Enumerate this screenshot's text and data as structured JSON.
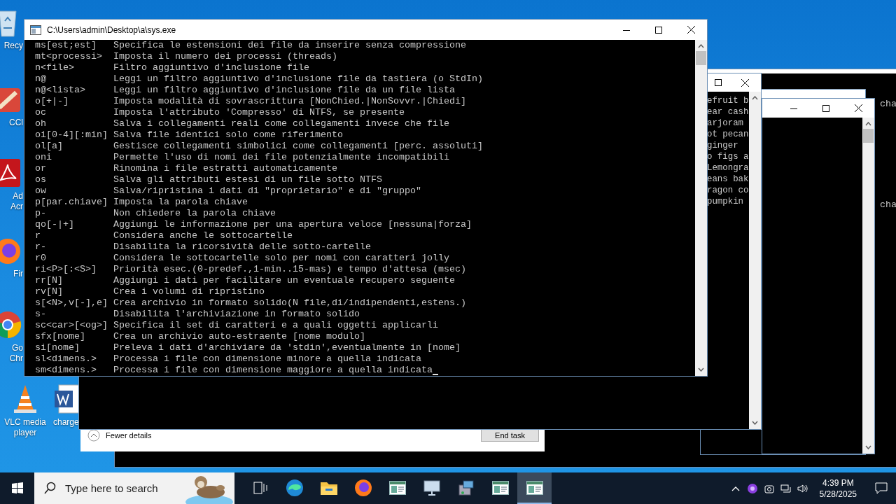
{
  "desktop_icons": [
    {
      "label": "Recy",
      "kind": "recycle"
    },
    {
      "label": "CCl",
      "kind": "ccleaner"
    },
    {
      "label": "Ad Acr",
      "kind": "acrobat"
    },
    {
      "label": "Fir",
      "kind": "firefox"
    },
    {
      "label": "Go Chr",
      "kind": "chrome"
    },
    {
      "label": "VLC media player",
      "kind": "vlc"
    },
    {
      "label": "charge",
      "kind": "word"
    }
  ],
  "back_console": {
    "lines": [
      "efruit b",
      "ear cash",
      "arjoram",
      "ot pecan",
      "ginger",
      "o figs a",
      "Lemongra",
      "eans bak",
      "ragon co",
      "pumpkin"
    ],
    "right_texts": [
      "cha",
      "cha"
    ]
  },
  "task_manager": {
    "toggle": "Fewer details",
    "button": "End task"
  },
  "main_window": {
    "title": "C:\\Users\\admin\\Desktop\\a\\sys.exe",
    "lines": [
      {
        "option": "ms[est;est]",
        "description": "Specifica le estensioni dei file da inserire senza compressione"
      },
      {
        "option": "mt<processi>",
        "description": "Imposta il numero dei processi (threads)"
      },
      {
        "option": "n<file>",
        "description": "Filtro aggiuntivo d'inclusione file"
      },
      {
        "option": "n@",
        "description": "Leggi un filtro aggiuntivo d'inclusione file da tastiera (o StdIn)"
      },
      {
        "option": "n@<lista>",
        "description": "Leggi un filtro aggiuntivo d'inclusione file da un file lista"
      },
      {
        "option": "o[+|-]",
        "description": "Imposta modalità di sovrascrittura [NonChied.|NonSovvr.|Chiedi]"
      },
      {
        "option": "oc",
        "description": "Imposta l'attributo 'Compresso' di NTFS, se presente"
      },
      {
        "option": "oh",
        "description": "Salva i collegamenti reali come collegamenti invece che file"
      },
      {
        "option": "oi[0-4][:min]",
        "description": "Salva file identici solo come riferimento"
      },
      {
        "option": "ol[a]",
        "description": "Gestisce collegamenti simbolici come collegamenti [perc. assoluti]"
      },
      {
        "option": "oni",
        "description": "Permette l'uso di nomi dei file potenzialmente incompatibili"
      },
      {
        "option": "or",
        "description": "Rinomina i file estratti automaticamente"
      },
      {
        "option": "os",
        "description": "Salva gli attributi estesi di un file sotto NTFS"
      },
      {
        "option": "ow",
        "description": "Salva/ripristina i dati di \"proprietario\" e di \"gruppo\""
      },
      {
        "option": "p[par.chiave]",
        "description": "Imposta la parola chiave"
      },
      {
        "option": "p-",
        "description": "Non chiedere la parola chiave"
      },
      {
        "option": "qo[-|+]",
        "description": "Aggiungi le informazione per una apertura veloce [nessuna|forza]"
      },
      {
        "option": "r",
        "description": "Considera anche le sottocartelle"
      },
      {
        "option": "r-",
        "description": "Disabilita la ricorsività delle sotto-cartelle"
      },
      {
        "option": "r0",
        "description": "Considera le sottocartelle solo per nomi con caratteri jolly"
      },
      {
        "option": "ri<P>[:<S>]",
        "description": "Priorità esec.(0-predef.,1-min..15-mas) e tempo d'attesa (msec)"
      },
      {
        "option": "rr[N]",
        "description": "Aggiungi i dati per facilitare un eventuale recupero seguente"
      },
      {
        "option": "rv[N]",
        "description": "Crea i volumi di ripristino"
      },
      {
        "option": "s[<N>,v[-],e]",
        "description": "Crea archivio in formato solido(N file,di/indipendenti,estens.)"
      },
      {
        "option": "s-",
        "description": "Disabilita l'archiviazione in formato solido"
      },
      {
        "option": "sc<car>[<og>]",
        "description": "Specifica il set di caratteri e a quali oggetti applicarli"
      },
      {
        "option": "sfx[nome]",
        "description": "Crea un archivio auto-estraente [nome modulo]"
      },
      {
        "option": "si[nome]",
        "description": "Preleva i dati d'archiviare da 'stdin',eventualmente in [nome]"
      },
      {
        "option": "sl<dimens.>",
        "description": "Processa i file con dimensione minore a quella indicata"
      },
      {
        "option": "sm<dimens.>",
        "description": "Processa i file con dimensione maggiore a quella indicata"
      }
    ]
  },
  "taskbar": {
    "search": {
      "placeholder": "Type here to search"
    },
    "apps": [
      {
        "kind": "taskview",
        "active": false
      },
      {
        "kind": "edge",
        "active": false
      },
      {
        "kind": "explorer",
        "active": false
      },
      {
        "kind": "firefox",
        "active": false
      },
      {
        "kind": "console",
        "active": false
      },
      {
        "kind": "monitor",
        "active": false
      },
      {
        "kind": "setup",
        "active": false
      },
      {
        "kind": "console",
        "active": false
      },
      {
        "kind": "console",
        "active": true
      }
    ],
    "time": "4:39 PM",
    "date": "5/28/2025"
  }
}
